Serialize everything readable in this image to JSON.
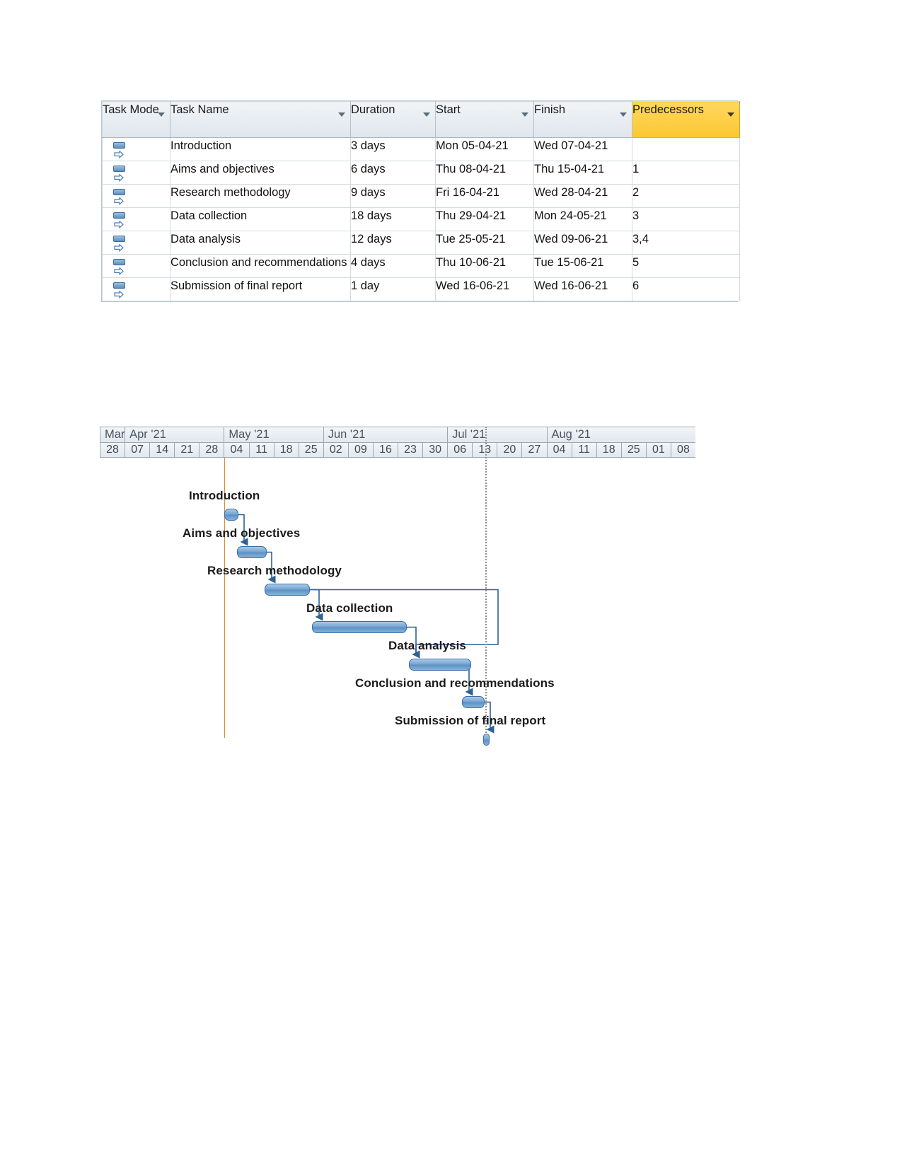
{
  "table": {
    "columns": [
      {
        "label": "Task Mode",
        "key": "mode"
      },
      {
        "label": "Task Name",
        "key": "name"
      },
      {
        "label": "Duration",
        "key": "duration"
      },
      {
        "label": "Start",
        "key": "start"
      },
      {
        "label": "Finish",
        "key": "finish"
      },
      {
        "label": "Predecessors",
        "key": "predecessors"
      }
    ],
    "highlight_column": "Predecessors",
    "highlight_color": "#fcc832",
    "rows": [
      {
        "mode_icon": "auto-schedule-icon",
        "name": "Introduction",
        "duration": "3 days",
        "start": "Mon 05-04-21",
        "finish": "Wed 07-04-21",
        "predecessors": ""
      },
      {
        "mode_icon": "auto-schedule-icon",
        "name": "Aims and objectives",
        "duration": "6 days",
        "start": "Thu 08-04-21",
        "finish": "Thu 15-04-21",
        "predecessors": "1"
      },
      {
        "mode_icon": "auto-schedule-icon",
        "name": "Research methodology",
        "duration": "9 days",
        "start": "Fri 16-04-21",
        "finish": "Wed 28-04-21",
        "predecessors": "2"
      },
      {
        "mode_icon": "auto-schedule-icon",
        "name": "Data collection",
        "duration": "18 days",
        "start": "Thu 29-04-21",
        "finish": "Mon 24-05-21",
        "predecessors": "3"
      },
      {
        "mode_icon": "auto-schedule-icon",
        "name": "Data analysis",
        "duration": "12 days",
        "start": "Tue 25-05-21",
        "finish": "Wed 09-06-21",
        "predecessors": "3,4"
      },
      {
        "mode_icon": "auto-schedule-icon",
        "name": "Conclusion and recommendations",
        "duration": "4 days",
        "start": "Thu 10-06-21",
        "finish": "Tue 15-06-21",
        "predecessors": "5"
      },
      {
        "mode_icon": "auto-schedule-icon",
        "name": "Submission of final report",
        "duration": "1 day",
        "start": "Wed 16-06-21",
        "finish": "Wed 16-06-21",
        "predecessors": "6"
      }
    ]
  },
  "chart_data": {
    "type": "bar",
    "title": "Gantt chart timeline",
    "xlabel": "",
    "ylabel": "",
    "timescale": {
      "months": [
        "Mar '21",
        "Apr '21",
        "May '21",
        "Jun '21",
        "Jul '21",
        "Aug '21"
      ],
      "weeks": [
        "28",
        "07",
        "14",
        "21",
        "28",
        "04",
        "11",
        "18",
        "25",
        "02",
        "09",
        "16",
        "23",
        "30",
        "06",
        "13",
        "20",
        "27",
        "04",
        "11",
        "18",
        "25",
        "01",
        "08"
      ]
    },
    "markers": {
      "today_line_color": "#e08a2e",
      "status_line_style": "dotted",
      "status_line_color": "#8f8f8f"
    },
    "bar_color": "#5d92c6",
    "bars": [
      {
        "label": "Introduction",
        "start": "Mon 05-04-21",
        "finish": "Wed 07-04-21",
        "duration_days": 3,
        "predecessors": ""
      },
      {
        "label": "Aims and objectives",
        "start": "Thu 08-04-21",
        "finish": "Thu 15-04-21",
        "duration_days": 6,
        "predecessors": "1"
      },
      {
        "label": "Research methodology",
        "start": "Fri 16-04-21",
        "finish": "Wed 28-04-21",
        "duration_days": 9,
        "predecessors": "2"
      },
      {
        "label": "Data collection",
        "start": "Thu 29-04-21",
        "finish": "Mon 24-05-21",
        "duration_days": 18,
        "predecessors": "3"
      },
      {
        "label": "Data analysis",
        "start": "Tue 25-05-21",
        "finish": "Wed 09-06-21",
        "duration_days": 12,
        "predecessors": "3,4"
      },
      {
        "label": "Conclusion and recommendations",
        "start": "Thu 10-06-21",
        "finish": "Tue 15-06-21",
        "duration_days": 4,
        "predecessors": "5"
      },
      {
        "label": "Submission of final report",
        "start": "Wed 16-06-21",
        "finish": "Wed 16-06-21",
        "duration_days": 1,
        "predecessors": "6"
      }
    ]
  }
}
